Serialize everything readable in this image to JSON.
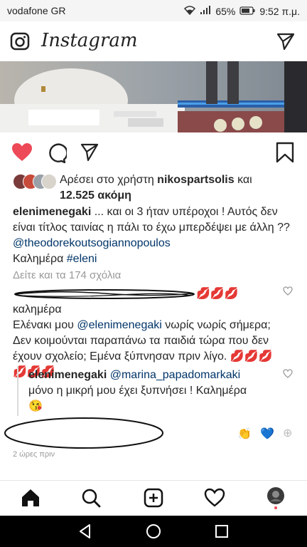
{
  "status": {
    "carrier": "vodafone GR",
    "battery": "65%",
    "time": "9:52 π.μ."
  },
  "app": {
    "title": "Instagram"
  },
  "post": {
    "likes": {
      "prefix": "Αρέσει στο χρήστη ",
      "user": "nikospartsolis",
      "and": " και",
      "count": "12.525 ακόμη"
    },
    "caption": {
      "user": "elenimenegaki",
      "text": " ... και οι 3 ήταν υπέροχοι ! Αυτός δεν είναι τίτλος ταινίας η πάλι το έχω μπερδέψει με άλλη ??",
      "mention": "@theodorekoutsogiannopoulos",
      "text2": "Καλημέρα ",
      "hashtag": "#eleni"
    },
    "view_all": "Δείτε και τα 174 σχόλια",
    "comment1": {
      "lips": "💋💋💋",
      "text_a": " καλημέρα",
      "text_b": "Ελένακι μου ",
      "mention": "@elenimenegaki",
      "text_c": "  νωρίς νωρίς σήμερα; Δεν κοιμούνται παραπάνω τα παιδιά τώρα που δεν έχουν σχολείο; Εμένα ξύπνησαν πριν λίγο. ",
      "lips2": "💋💋💋💋💋💋"
    },
    "reply": {
      "user": "elenimenegaki",
      "mention": "@marina_papadomarkaki",
      "text": " μόνο η μικρή μου έχει ξυπνήσει ! Καλημέρα",
      "emoji": "😘"
    },
    "reactions": {
      "clap": "👏",
      "heart": "💙",
      "plus": "⊕"
    },
    "time": "2 ώρες πριν"
  },
  "icons": {
    "camera": "camera-icon",
    "send": "send-icon",
    "like": "heart-icon",
    "comment": "comment-icon",
    "share": "share-icon",
    "bookmark": "bookmark-icon",
    "home": "home-icon",
    "search": "search-icon",
    "add": "add-icon",
    "activity": "heart-outline-icon",
    "profile": "profile-avatar"
  },
  "colors": {
    "like": "#ed4956",
    "link": "#003569",
    "muted": "#999999"
  }
}
